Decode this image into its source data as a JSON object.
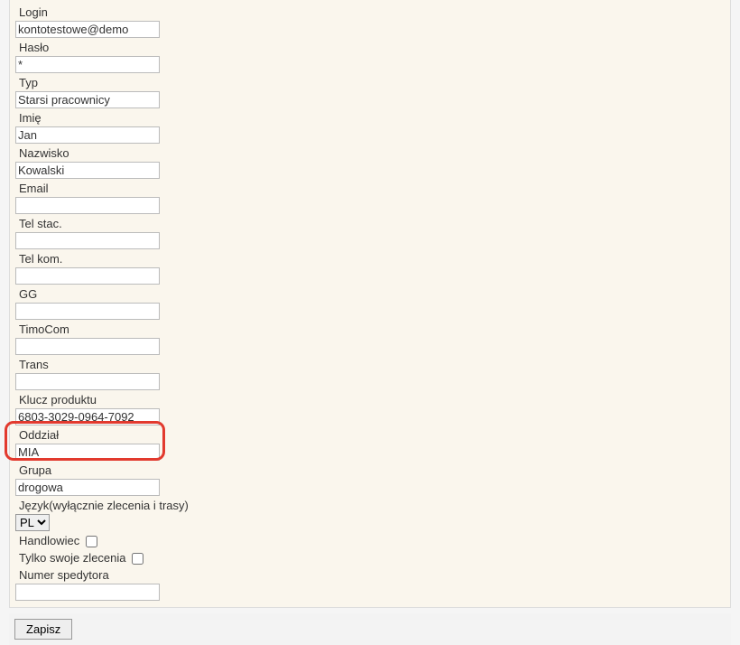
{
  "labels": {
    "login": "Login",
    "password": "Hasło",
    "type": "Typ",
    "firstname": "Imię",
    "lastname": "Nazwisko",
    "email": "Email",
    "phone_landline": "Tel stac.",
    "phone_mobile": "Tel kom.",
    "gg": "GG",
    "timocom": "TimoCom",
    "trans": "Trans",
    "product_key": "Klucz produktu",
    "branch": "Oddział",
    "group": "Grupa",
    "language": "Język(wyłącznie zlecenia i trasy)",
    "salesperson": "Handlowiec",
    "only_own_orders": "Tylko swoje zlecenia",
    "forwarder_number": "Numer spedytora"
  },
  "values": {
    "login": "kontotestowe@demo",
    "password": "*",
    "type": "Starsi pracownicy",
    "firstname": "Jan",
    "lastname": "Kowalski",
    "email": "",
    "phone_landline": "",
    "phone_mobile": "",
    "gg": "",
    "timocom": "",
    "trans": "",
    "product_key": "6803-3029-0964-7092",
    "branch": "MIA",
    "group": "drogowa",
    "language": "PL",
    "forwarder_number": ""
  },
  "buttons": {
    "save": "Zapisz"
  }
}
